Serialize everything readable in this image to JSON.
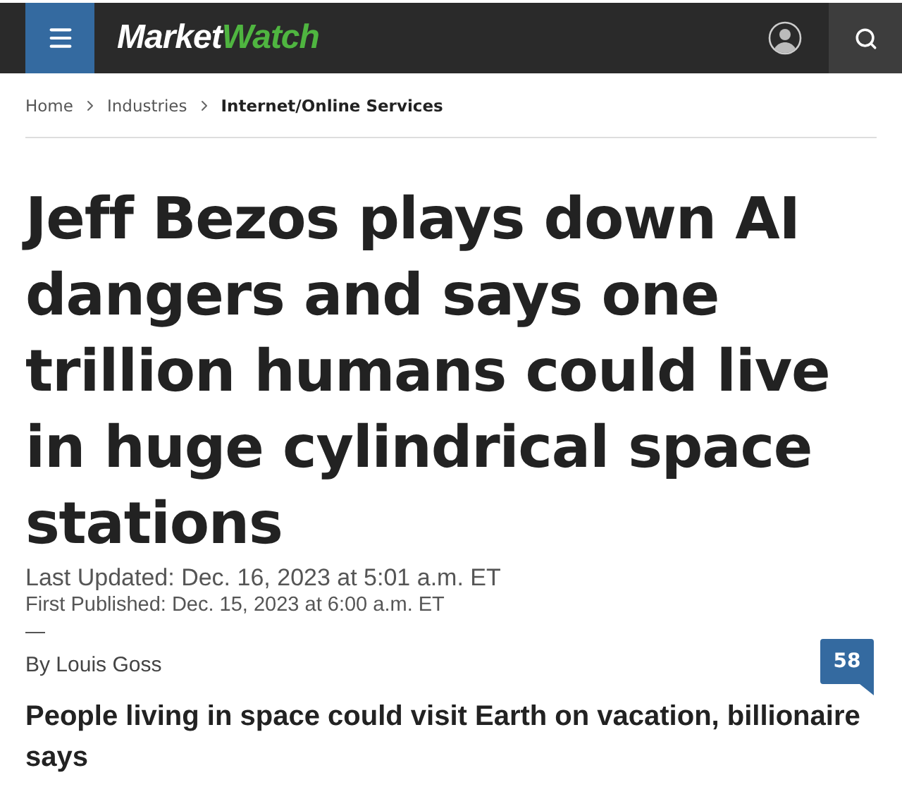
{
  "header": {
    "logo": {
      "first": "Market",
      "second": "Watch"
    }
  },
  "breadcrumbs": [
    {
      "label": "Home",
      "current": false
    },
    {
      "label": "Industries",
      "current": false
    },
    {
      "label": "Internet/Online Services",
      "current": true
    }
  ],
  "article": {
    "headline": "Jeff Bezos plays down AI dangers and says one trillion humans could live in huge cylindrical space stations",
    "last_updated": "Last Updated: Dec. 16, 2023 at 5:01 a.m. ET",
    "first_published": "First Published: Dec. 15, 2023 at 6:00 a.m. ET",
    "byline": "By Louis Goss",
    "comment_count": "58",
    "subheadline": "People living in space could visit Earth on vacation, billionaire says"
  }
}
